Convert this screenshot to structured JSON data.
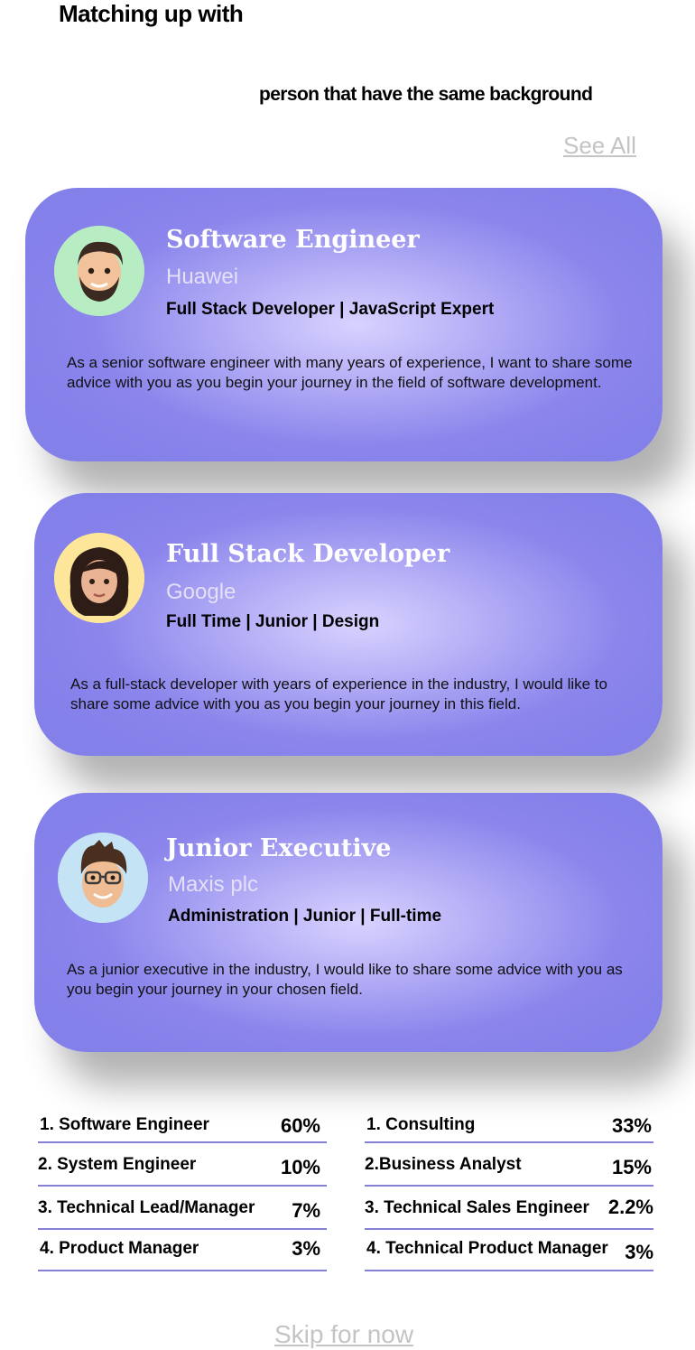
{
  "header": {
    "title": "Matching up with",
    "subtitle": "person that have the same background",
    "see_all": "See All"
  },
  "cards": [
    {
      "title": "Software Engineer",
      "company": "Huawei",
      "tags": "Full Stack Developer | JavaScript Expert",
      "description": "As a senior software engineer with many years of experience, I want to share some advice with you as you begin your journey in the field of software development.",
      "avatar_bg": "#b8edc4"
    },
    {
      "title": "Full Stack Developer",
      "company": "Google",
      "tags": "Full Time | Junior | Design",
      "description": "As a full-stack developer with years of experience in the industry, I would like to share some advice with you as you begin your journey in this field.",
      "avatar_bg": "#fde69a"
    },
    {
      "title": "Junior Executive",
      "company": "Maxis plc",
      "tags": "Administration | Junior | Full-time",
      "description": "As a junior executive in the industry, I would like to share some advice with you as you begin your journey in your chosen field.",
      "avatar_bg": "#c4e4f5"
    }
  ],
  "stats_left": [
    {
      "label": "1. Software Engineer",
      "value": "60%"
    },
    {
      "label": "2. System Engineer",
      "value": "10%"
    },
    {
      "label": "3. Technical Lead/Manager",
      "value": "7%"
    },
    {
      "label": "4. Product Manager",
      "value": "3%"
    }
  ],
  "stats_right": [
    {
      "label": "1. Consulting",
      "value": "33%"
    },
    {
      "label": "2.Business Analyst",
      "value": "15%"
    },
    {
      "label": "3. Technical Sales Engineer",
      "value": "2.2%"
    },
    {
      "label": "4. Technical Product Manager",
      "value": "3%"
    }
  ],
  "footer": {
    "skip": "Skip for now"
  },
  "colors": {
    "card": "#8480ea",
    "divider": "#8480d4",
    "muted_link": "#c4c4c4"
  }
}
